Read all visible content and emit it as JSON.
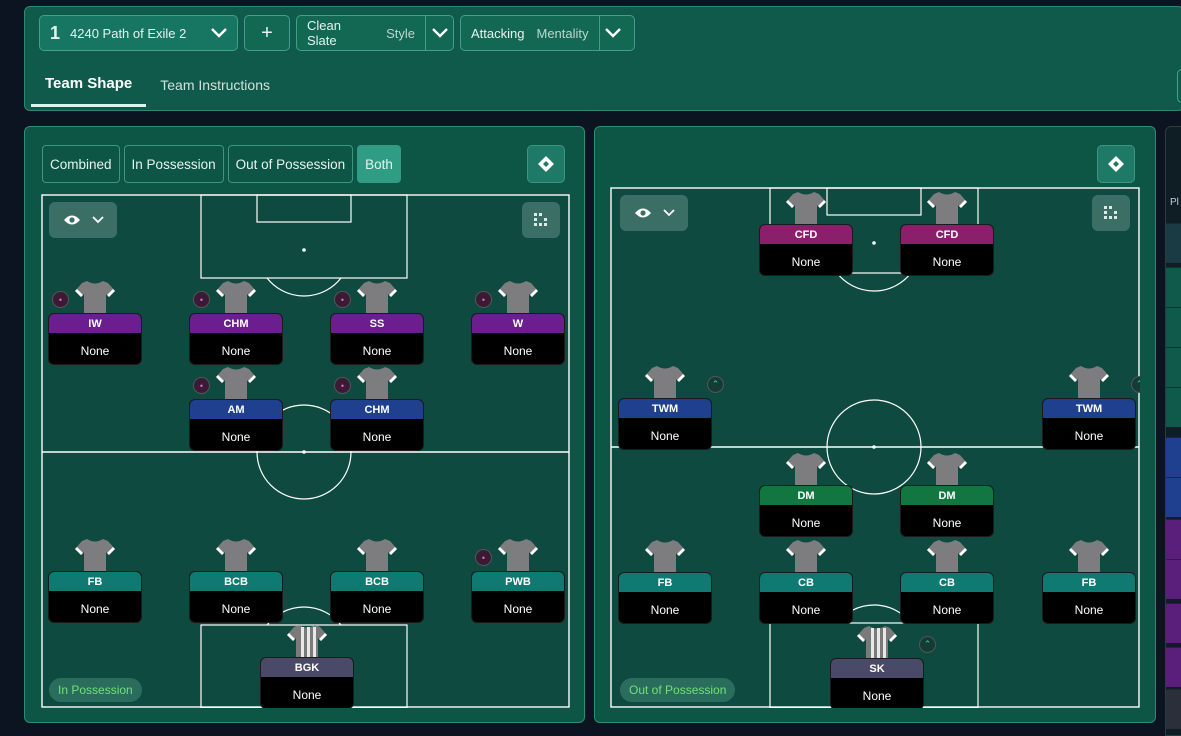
{
  "toolbar": {
    "tactic_number": "1",
    "tactic_name": "4240 Path of Exile 2",
    "add_label": "+",
    "style_value": "Clean Slate",
    "style_label": "Style",
    "mentality_value": "Attacking",
    "mentality_label": "Mentality"
  },
  "tabs": [
    {
      "label": "Team Shape",
      "active": true
    },
    {
      "label": "Team Instructions",
      "active": false
    }
  ],
  "left_panel": {
    "segments": [
      {
        "label": "Combined",
        "active": false
      },
      {
        "label": "In Possession",
        "active": false
      },
      {
        "label": "Out of Possession",
        "active": false
      },
      {
        "label": "Both",
        "active": true
      }
    ],
    "phase_label": "In Possession",
    "players": [
      {
        "role": "IW",
        "duty": "None",
        "color": "#6b1f8f",
        "ind": "pink"
      },
      {
        "role": "CHM",
        "duty": "None",
        "color": "#6b1f8f",
        "ind": "pink"
      },
      {
        "role": "SS",
        "duty": "None",
        "color": "#6b1f8f",
        "ind": "pink"
      },
      {
        "role": "W",
        "duty": "None",
        "color": "#6b1f8f",
        "ind": "pink"
      },
      {
        "role": "AM",
        "duty": "None",
        "color": "#1f3f8f",
        "ind": "pink"
      },
      {
        "role": "CHM",
        "duty": "None",
        "color": "#1f3f8f",
        "ind": "pink"
      },
      {
        "role": "FB",
        "duty": "None",
        "color": "#0f7a72",
        "ind": ""
      },
      {
        "role": "BCB",
        "duty": "None",
        "color": "#0f7a72",
        "ind": ""
      },
      {
        "role": "BCB",
        "duty": "None",
        "color": "#0f7a72",
        "ind": ""
      },
      {
        "role": "PWB",
        "duty": "None",
        "color": "#0f7a72",
        "ind": "pink"
      },
      {
        "role": "BGK",
        "duty": "None",
        "color": "#4a4a68",
        "ind": "",
        "gk": true
      }
    ]
  },
  "right_panel": {
    "phase_label": "Out of Possession",
    "players": [
      {
        "role": "CFD",
        "duty": "None",
        "color": "#8c1f6b",
        "ind": ""
      },
      {
        "role": "CFD",
        "duty": "None",
        "color": "#8c1f6b",
        "ind": ""
      },
      {
        "role": "TWM",
        "duty": "None",
        "color": "#1f3f8f",
        "ind": "teal"
      },
      {
        "role": "TWM",
        "duty": "None",
        "color": "#1f3f8f",
        "ind": "teal"
      },
      {
        "role": "DM",
        "duty": "None",
        "color": "#11763f",
        "ind": ""
      },
      {
        "role": "DM",
        "duty": "None",
        "color": "#11763f",
        "ind": ""
      },
      {
        "role": "FB",
        "duty": "None",
        "color": "#0f7a72",
        "ind": ""
      },
      {
        "role": "CB",
        "duty": "None",
        "color": "#0f7a72",
        "ind": ""
      },
      {
        "role": "CB",
        "duty": "None",
        "color": "#0f7a72",
        "ind": ""
      },
      {
        "role": "FB",
        "duty": "None",
        "color": "#0f7a72",
        "ind": ""
      },
      {
        "role": "SK",
        "duty": "None",
        "color": "#4a4a68",
        "ind": "teal",
        "gk": true
      }
    ]
  },
  "side_panel": {
    "header_fragment": "Pl"
  }
}
